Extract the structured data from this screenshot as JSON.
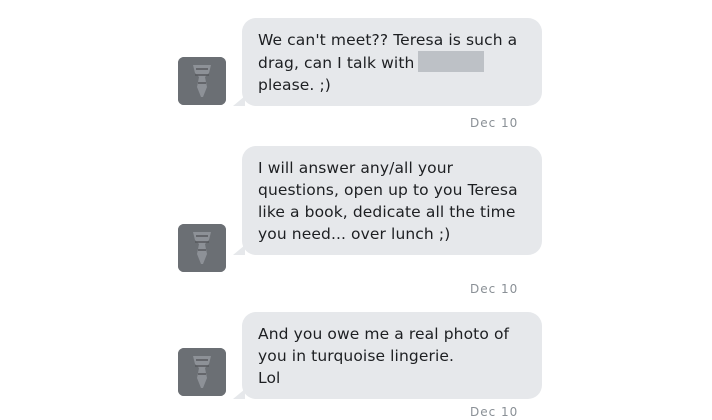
{
  "messages": [
    {
      "text_before_redaction": "We can't meet?? Teresa is such a drag, can I talk with",
      "text_after_redaction": "please. ;)",
      "timestamp": "Dec 10"
    },
    {
      "text": "I will answer any/all your questions, open up to you Teresa like a book, dedicate all the time you need... over lunch ;)",
      "timestamp": "Dec 10"
    },
    {
      "text": "And you owe me a real photo of you in turquoise lingerie.",
      "text_line2": "Lol",
      "timestamp": "Dec 10"
    }
  ],
  "colors": {
    "bubble": "#e6e8eb",
    "timestamp": "#8a9096",
    "avatar": "#6f7378"
  },
  "icons": {
    "avatar": "user-avatar-icon"
  }
}
